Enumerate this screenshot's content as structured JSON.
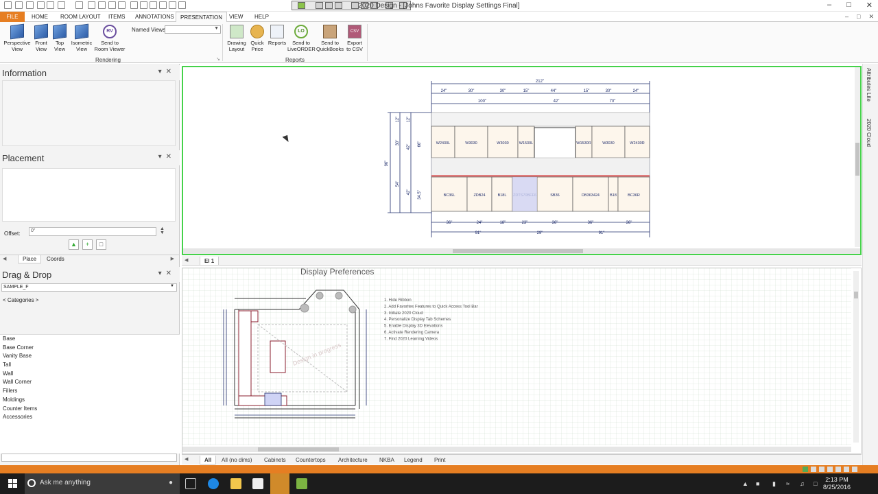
{
  "window": {
    "title": "2020 Design - [Johns Favorite Display Settings Final]"
  },
  "ribbon_tabs": [
    {
      "label": "FILE"
    },
    {
      "label": "HOME"
    },
    {
      "label": "ROOM LAYOUT"
    },
    {
      "label": "ITEMS"
    },
    {
      "label": "ANNOTATIONS"
    },
    {
      "label": "PRESENTATION"
    },
    {
      "label": "VIEW"
    },
    {
      "label": "HELP"
    }
  ],
  "ribbon": {
    "named_views_label": "Named Views",
    "named_views_value": "",
    "rendering_group": "Rendering",
    "reports_group": "Reports",
    "buttons": [
      {
        "label": "Perspective View",
        "icon": "perspective-view-icon"
      },
      {
        "label": "Front View",
        "icon": "front-view-icon"
      },
      {
        "label": "Top View",
        "icon": "top-view-icon"
      },
      {
        "label": "Isometric View",
        "icon": "isometric-view-icon"
      },
      {
        "label": "Send to Room Viewer",
        "icon": "room-viewer-icon",
        "icon_text": "RV"
      },
      {
        "label": "Drawing Layout",
        "icon": "drawing-layout-icon"
      },
      {
        "label": "Quick Price",
        "icon": "coins-icon"
      },
      {
        "label": "Reports",
        "icon": "reports-icon"
      },
      {
        "label": "Send to LiveORDER",
        "icon": "liveorder-icon",
        "icon_text": "LO"
      },
      {
        "label": "Send to QuickBooks",
        "icon": "quickbooks-icon"
      },
      {
        "label": "Export to CSV",
        "icon": "csv-icon",
        "icon_text": "CSV"
      }
    ]
  },
  "panels": {
    "information": {
      "title": "Information"
    },
    "placement": {
      "title": "Placement",
      "offset_label": "Offset:",
      "offset_value": "0\"",
      "tabs": [
        "Place",
        "Coords"
      ]
    },
    "drag_drop": {
      "title": "Drag & Drop",
      "catalog": "SAMPLE_F",
      "categories_label": "< Categories >",
      "items": [
        "Base",
        "Base Corner",
        "Vanity Base",
        "Tall",
        "Wall",
        "Wall Corner",
        "Fillers",
        "Moldings",
        "Counter Items",
        "Accessories"
      ]
    }
  },
  "elevation": {
    "tab_label": "El 1",
    "top_dims": [
      "212\"",
      "24\"",
      "30\"",
      "30\"",
      "15\"",
      "44\"",
      "15\"",
      "30\"",
      "24\"",
      "100\"",
      "42\"",
      "70\""
    ],
    "side_dims": [
      "96\"",
      "12\"",
      "12\"",
      "30\"",
      "42\"",
      "66\"",
      "54\"",
      "42\"",
      "34.5\""
    ],
    "wall_cabinets": [
      "W2430L",
      "W3030",
      "W3030",
      "W1530L",
      "W1530R",
      "W3030",
      "W2430R"
    ],
    "base_cabinets": [
      "BC36L",
      "ZDB24",
      "B18L",
      "ZDTS70BFF6",
      "SB36",
      "DB363424",
      "B18",
      "BC36R"
    ],
    "bottom_dims": [
      "36\"",
      "24\"",
      "18\"",
      "23\"",
      "36\"",
      "36\"",
      "36\"",
      "91\"",
      "29\"",
      "91\""
    ]
  },
  "plan": {
    "heading": "Display Preferences",
    "watermark": "Design in progress",
    "notes": [
      "1. Hide Ribbon",
      "2. Add Favorites Features to Quick Access Tool Bar",
      "3. Initiate 2020 Cloud",
      "4. Personalize Display Tab Schemes",
      "5. Enable Display 3D Elevations",
      "6. Activate Rendering Camera",
      "7. Find 2020 Learning Videos"
    ]
  },
  "bottom_tabs": [
    "All",
    "All (no dims)",
    "Cabinets",
    "Countertops",
    "Architecture",
    "NKBA",
    "Legend",
    "Print"
  ],
  "right_strip": [
    "Attributes Lite",
    "2020 Cloud"
  ],
  "taskbar": {
    "search_placeholder": "Ask me anything",
    "time": "2:13 PM",
    "date": "8/25/2016"
  },
  "colors": {
    "accent": "#e67e22",
    "active_view_border": "#45d24a",
    "dim_line": "#1d2b6a",
    "cabinet_fill": "#fdf6ec",
    "counter_red": "#e07b7b"
  }
}
